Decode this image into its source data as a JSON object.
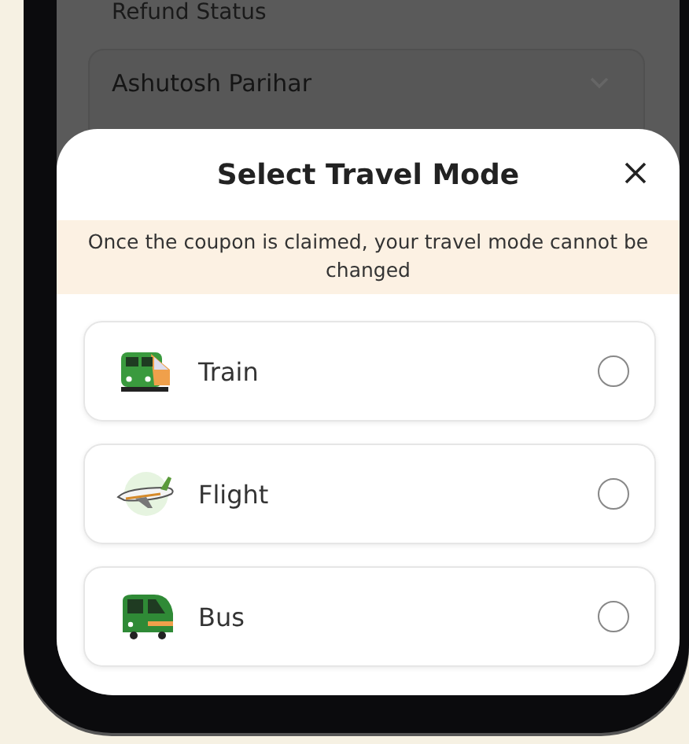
{
  "background": {
    "label": "Refund Status",
    "dropdown_value": "Ashutosh Parihar"
  },
  "sheet": {
    "title": "Select Travel Mode",
    "notice": "Once the coupon is claimed, your travel mode cannot be changed",
    "options": [
      {
        "kind": "train",
        "label": "Train",
        "selected": false
      },
      {
        "kind": "flight",
        "label": "Flight",
        "selected": false
      },
      {
        "kind": "bus",
        "label": "Bus",
        "selected": false
      }
    ]
  }
}
